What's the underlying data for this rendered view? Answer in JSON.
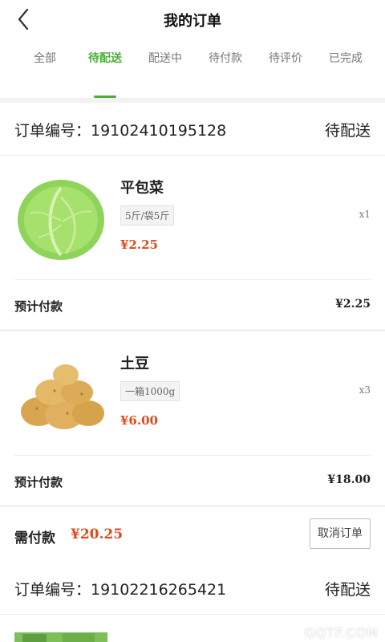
{
  "header": {
    "title": "我的订单",
    "back_icon": "chevron-left-icon"
  },
  "tabs": [
    {
      "label": "全部",
      "active": false
    },
    {
      "label": "待配送",
      "active": true
    },
    {
      "label": "配送中",
      "active": false
    },
    {
      "label": "待付款",
      "active": false
    },
    {
      "label": "待评价",
      "active": false
    },
    {
      "label": "已完成",
      "active": false
    }
  ],
  "colors": {
    "accent_green": "#4caf3a",
    "price_red": "#e04a1c"
  },
  "orders": [
    {
      "order_no": "订单编号：19102410195128",
      "status": "待配送",
      "items": [
        {
          "name": "平包菜",
          "spec": "5斤/袋5斤",
          "qty": "x1",
          "price": "¥2.25",
          "estimate_label": "预计付款",
          "estimate_amount": "¥2.25",
          "image": "cabbage-image"
        },
        {
          "name": "土豆",
          "spec": "一箱1000g",
          "qty": "x3",
          "price": "¥6.00",
          "estimate_label": "预计付款",
          "estimate_amount": "¥18.00",
          "image": "potato-image"
        }
      ],
      "pay_label": "需付款",
      "pay_amount": "¥20.25",
      "cancel_label": "取消订单"
    },
    {
      "order_no": "订单编号：19102216265421",
      "status": "待配送"
    }
  ],
  "watermark": "QQTF.COM"
}
